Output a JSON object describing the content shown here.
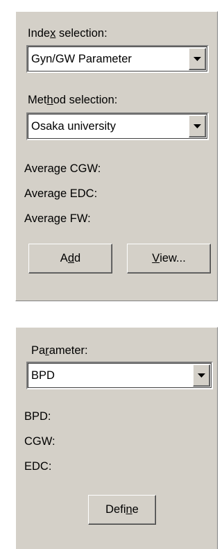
{
  "index_section": {
    "index_label_parts": [
      "Inde",
      "x",
      " selection:"
    ],
    "index_value": "Gyn/GW Parameter",
    "method_label_parts": [
      "Met",
      "h",
      "od selection:"
    ],
    "method_value": "Osaka university",
    "averages": [
      "Average CGW:",
      "Average EDC:",
      "Average FW:"
    ],
    "add_label_parts": [
      "A",
      "d",
      "d"
    ],
    "view_label_parts": [
      "",
      "V",
      "iew..."
    ]
  },
  "parameter_section": {
    "parameter_label_parts": [
      "Pa",
      "r",
      "ameter:"
    ],
    "parameter_value": "BPD",
    "results": [
      "BPD:",
      "CGW:",
      "EDC:"
    ],
    "define_label_parts": [
      "Defi",
      "n",
      "e"
    ]
  },
  "colors": {
    "panel_bg": "#d4d0c8",
    "field_bg": "#ffffff",
    "shadow": "#808080",
    "highlight": "#ffffff"
  }
}
